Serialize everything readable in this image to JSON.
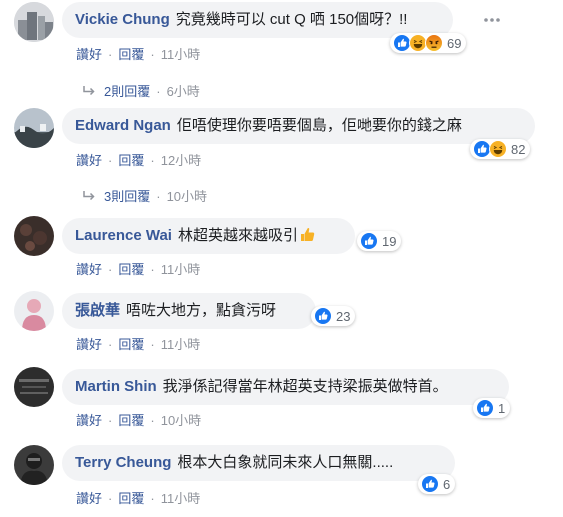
{
  "comments": [
    {
      "author": "Vickie Chung",
      "text": "究竟幾時可以 cut Q 哂 150個呀？!!",
      "reaction_count": "69",
      "actions": {
        "like": "讚好",
        "reply": "回覆",
        "time": "11小時"
      },
      "replies": {
        "label": "2則回覆",
        "time": "6小時"
      }
    },
    {
      "author": "Edward Ngan",
      "text": "佢唔使理你要唔要個島，佢哋要你的錢之麻",
      "reaction_count": "82",
      "actions": {
        "like": "讚好",
        "reply": "回覆",
        "time": "12小時"
      },
      "replies": {
        "label": "3則回覆",
        "time": "10小時"
      }
    },
    {
      "author": "Laurence Wai",
      "text": "林超英越來越吸引",
      "reaction_count": "19",
      "actions": {
        "like": "讚好",
        "reply": "回覆",
        "time": "11小時"
      }
    },
    {
      "author": "張啟華",
      "text": "唔咗大地方，點貪污呀",
      "reaction_count": "23",
      "actions": {
        "like": "讚好",
        "reply": "回覆",
        "time": "11小時"
      }
    },
    {
      "author": "Martin Shin",
      "text": "我淨係記得當年林超英支持梁振英做特首。",
      "reaction_count": "1",
      "actions": {
        "like": "讚好",
        "reply": "回覆",
        "time": "10小時"
      }
    },
    {
      "author": "Terry Cheung",
      "text": "根本大白象就同未來人口無關.....",
      "reaction_count": "6",
      "actions": {
        "like": "讚好",
        "reply": "回覆",
        "time": "11小時"
      }
    }
  ],
  "icons": {
    "like": "like-reaction-icon",
    "haha": "haha-reaction-icon",
    "angry": "angry-reaction-icon",
    "thumbs_up_emoji": "thumbs-up-emoji-icon",
    "more": "more-options-icon",
    "reply_arrow": "reply-arrow-icon"
  },
  "colors": {
    "author": "#385898",
    "bubble": "#f2f3f5",
    "meta": "#90949c",
    "like_blue": "#1877f2",
    "haha_yellow": "#f7b125",
    "angry_orange": "#e9710f"
  }
}
